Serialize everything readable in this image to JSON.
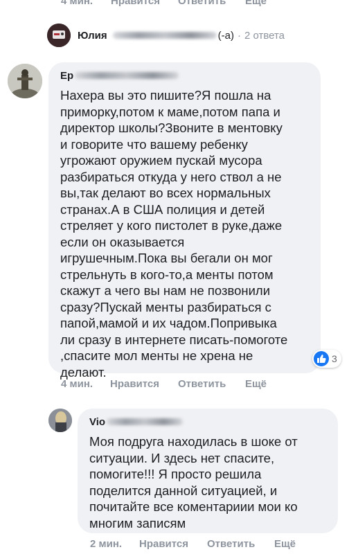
{
  "top_actions": {
    "time": "4 мин.",
    "like": "Нравится",
    "reply": "Ответить",
    "more": "Ещё"
  },
  "reply_summary": {
    "name": "Юлия",
    "suffix": "(-а)",
    "dot": "·",
    "count": "2 ответа"
  },
  "comment1": {
    "author_prefix": "Ер",
    "text": "Нахера вы это пишите?Я пошла на\nприморку,потом к маме,потом папа и\nдиректор школы?Звоните в ментовку\nи говорите что вашему ребенку\nугрожают оружием пускай мусора\nразбираться откуда у него ствол а не\nвы,так делают во всех нормальных\nстранах.А в США полиция и детей\nстреляет у кого пистолет в руке,даже\nесли он оказывается\nигрушечным.Пока вы бегали он мог\nстрельнуть в кого-то,а менты потом\nскажут а чего вы нам не позвонили\nсразу?Пускай менты разбираться с\nпапой,мамой и их чадом.Попривыка\nли сразу в интернете писать-помоготе\n,спасите мол менты не хрена не\nделают.",
    "likes": "3",
    "actions": {
      "time": "4 мин.",
      "like": "Нравится",
      "reply": "Ответить",
      "more": "Ещё"
    }
  },
  "comment2": {
    "author_prefix": "Vio",
    "text": "Моя подруга находилась в шоке от\nситуации. И здесь нет спасите,\nпомогите!!! Я просто решила\nподелится данной ситуацией, и\nпочитайте все коментариии мои ко\nмногим записям",
    "actions": {
      "time": "2 мин.",
      "like": "Нравится",
      "reply": "Ответить",
      "more": "Ещё"
    }
  },
  "colors": {
    "bubble": "#f0f1f4",
    "muted": "#8d949e",
    "link": "#65676b",
    "like_blue": "#1877f2"
  }
}
